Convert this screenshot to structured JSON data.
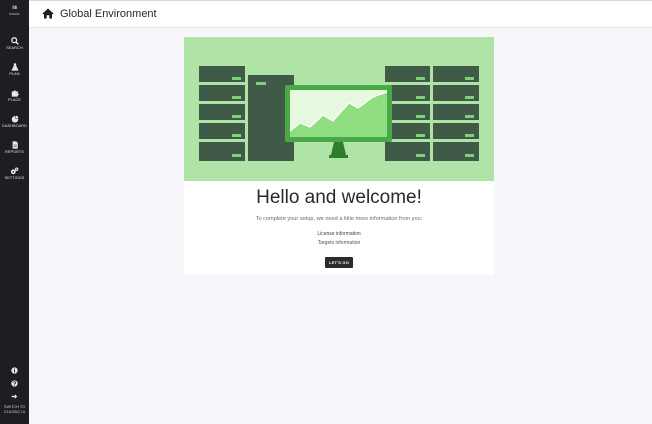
{
  "sidebar": {
    "logo_text": "cisco",
    "items": [
      {
        "label": "SEARCH",
        "icon": "search-icon"
      },
      {
        "label": "PLAN",
        "icon": "flask-icon"
      },
      {
        "label": "PLACE",
        "icon": "puzzle-icon"
      },
      {
        "label": "DASHBOARD",
        "icon": "pie-chart-icon"
      },
      {
        "label": "REPORTS",
        "icon": "document-icon"
      },
      {
        "label": "SETTINGS",
        "icon": "gears-icon"
      }
    ],
    "bottom_icons": [
      "info-icon",
      "help-icon",
      "switch-arrow-icon"
    ],
    "switch_label_line1": "SWITCH TO",
    "switch_label_line2": "CLASSIC UI"
  },
  "header": {
    "title": "Global Environment",
    "icon": "home-icon"
  },
  "welcome": {
    "heading": "Hello and welcome!",
    "subtitle": "To complete your setup, we need a little more information from you:",
    "link_license": "License information",
    "link_targets": "Targets information",
    "button_label": "LET'S GO"
  },
  "colors": {
    "sidebar_bg": "#1d1e22",
    "hero_bg": "#b0e4a6",
    "server_dark": "#3f5b47",
    "server_led": "#7fd07a",
    "monitor_screen": "#e6f9de",
    "chart_fill": "#8fde82",
    "monitor_frame": "#4aa846"
  }
}
